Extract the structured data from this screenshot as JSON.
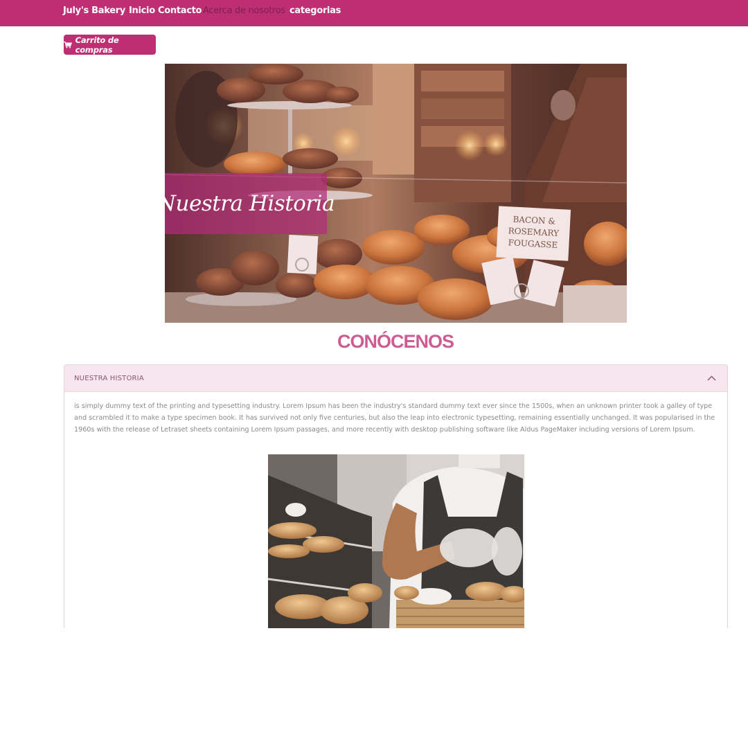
{
  "navbar": {
    "brand": "July's Bakery",
    "links": [
      {
        "label": "Inicio",
        "active": false
      },
      {
        "label": "Contacto",
        "active": false
      },
      {
        "label": "Acerca de nosotros",
        "active": true
      },
      {
        "label": "categorias",
        "active": false
      }
    ]
  },
  "cart": {
    "icon": "cart-icon",
    "label": "Carrito de compras"
  },
  "hero": {
    "caption": "Nuestra Historia",
    "sign_text": [
      "BACON &",
      "ROSEMARY",
      "FOUGASSE"
    ]
  },
  "section_title": "CONÓCENOS",
  "accordion": {
    "header": "NUESTRA HISTORIA",
    "toggle_icon": "chevron-up-icon",
    "body": "is simply dummy text of the printing and typesetting industry. Lorem Ipsum has been the industry's standard dummy text ever since the 1500s, when an unknown printer took a galley of type and scrambled it to make a type specimen book. It has survived not only five centuries, but also the leap into electronic typesetting, remaining essentially unchanged. It was popularised in the 1960s with the release of Letraset sheets containing Lorem Ipsum passages, and more recently with desktop publishing software like Aldus PageMaker including versions of Lorem Ipsum."
  },
  "colors": {
    "brand": "#bd2f72",
    "title": "#cc5d93",
    "accordion_header": "#f8e6ee"
  }
}
